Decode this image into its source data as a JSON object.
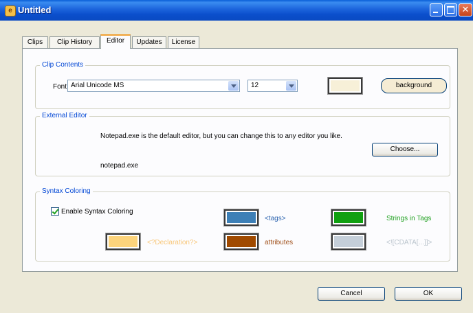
{
  "window": {
    "title": "Untitled"
  },
  "tabs": [
    {
      "label": "Clips"
    },
    {
      "label": "Clip History"
    },
    {
      "label": "Editor"
    },
    {
      "label": "Updates"
    },
    {
      "label": "License"
    }
  ],
  "active_tab": "Editor",
  "clip_contents": {
    "legend": "Clip Contents",
    "font_label": "Font",
    "font_value": "Arial Unicode MS",
    "size_value": "12",
    "swatch_color": "#f7f0d8",
    "background_button": "background"
  },
  "external_editor": {
    "legend": "External Editor",
    "description": "Notepad.exe is the default editor, but you can change this to any editor you like.",
    "current_editor": "notepad.exe",
    "choose_button": "Choose..."
  },
  "syntax_coloring": {
    "legend": "Syntax Coloring",
    "enable_label": "Enable Syntax Coloring",
    "enabled": true,
    "items": [
      {
        "label": "<tags>",
        "swatch": "#3d7fb6",
        "text_color": "#2f66b0"
      },
      {
        "label": "Strings in Tags",
        "swatch": "#10a010",
        "text_color": "#21a121"
      },
      {
        "label": "<?Declaration?>",
        "swatch": "#fdd47c",
        "text_color": "#f8c77a"
      },
      {
        "label": "attributes",
        "swatch": "#a04a00",
        "text_color": "#a0501a"
      },
      {
        "label": "<![CDATA[...]]>",
        "swatch": "#c5cfd9",
        "text_color": "#b9c3cc"
      }
    ]
  },
  "footer": {
    "cancel_button": "Cancel",
    "ok_button": "OK"
  }
}
